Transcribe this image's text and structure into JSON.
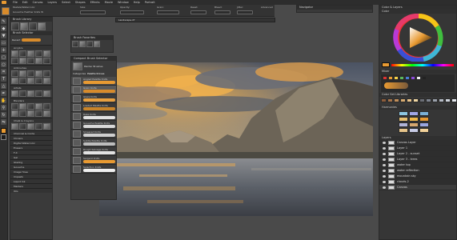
{
  "menu": [
    "File",
    "Edit",
    "Canvas",
    "Layers",
    "Select",
    "Shapes",
    "Effects",
    "Movie",
    "Window",
    "Help",
    "Portrait"
  ],
  "property_bar": {
    "brush_name": "Pastels/Watercolor",
    "brush_variant": "Gouache Feather Knife W",
    "labels": [
      "Size:",
      "Opacity:",
      "Grain:",
      "Resat:",
      "Bleed:",
      "Jitter:",
      "Advanced"
    ]
  },
  "brush_selector": {
    "title": "Brush Selector",
    "recent": "Recent",
    "categories_header": "Brush Library",
    "search_placeholder": "Search brushes",
    "filters": [
      "Brush Library",
      "Favorite",
      "Recent",
      "Stencils"
    ],
    "sections": [
      "Acrylics",
      "Airbrushes",
      "Artists",
      "Blenders",
      "Chalk & Crayons",
      "Charcoal & Conte",
      "Cloners",
      "Digital Watercolor",
      "Erasers",
      "F-X",
      "Gel",
      "Glazing",
      "Gouache",
      "Image Hose",
      "Impasto",
      "Liquid Ink",
      "Markers",
      "Oils"
    ]
  },
  "brush_popup": {
    "title": "Compact Brush Selector",
    "library": "Painter Brushes",
    "category": "Palette Knives",
    "header": "Categories",
    "favorites_label": "Brush Favorites",
    "variants": [
      "Angled Palette Knife",
      "Grain Knife",
      "Glaze Knife",
      "Loaded Palette Knife",
      "Rake Knife",
      "Gouache Palette Knife",
      "Smeared Knife",
      "Subtle Palette Knife",
      "Rough Salvage Knife",
      "Sargent Knife",
      "Selection Knife"
    ]
  },
  "document_tab": {
    "title": "Landscape.rif",
    "nav": "Navigator"
  },
  "right_panels": {
    "color_title": "Color & Layers",
    "color": "Color",
    "mixer": "Mixer",
    "color_sets": "Color Set Libraries",
    "harmonies": "Harmonies",
    "layers_title": "Layers",
    "layer_list_title": "Layers",
    "layers": [
      "Canvas Layer",
      "Layer 1",
      "Layer 2 - sunset",
      "Layer 3 - trees",
      "water top",
      "water reflection",
      "mountain sky",
      "clouds-2",
      "Canvas"
    ]
  },
  "colors": {
    "accent": "#e89a32",
    "selected_stroke": "#d88b2b"
  }
}
